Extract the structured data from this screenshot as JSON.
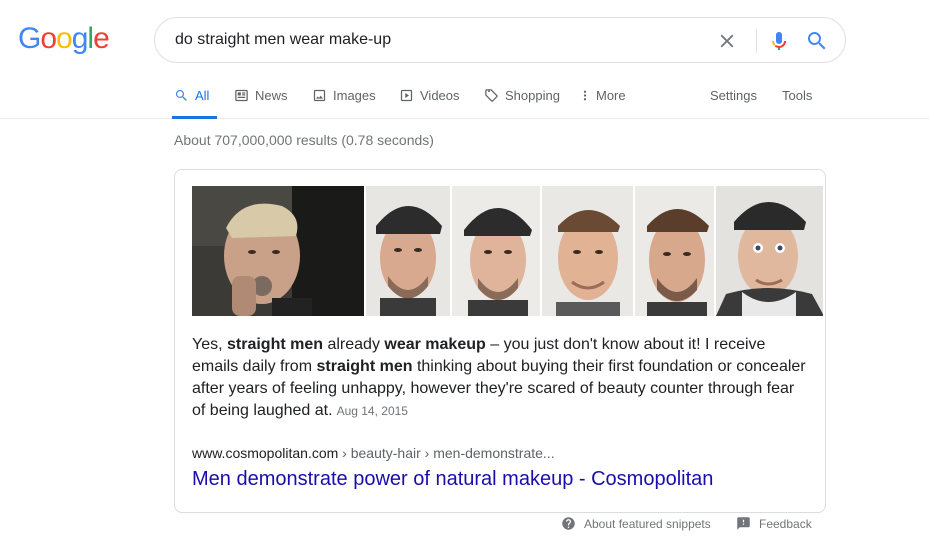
{
  "logo": {
    "letters": [
      {
        "char": "G",
        "color": "#4285F4"
      },
      {
        "char": "o",
        "color": "#EA4335"
      },
      {
        "char": "o",
        "color": "#FBBC05"
      },
      {
        "char": "g",
        "color": "#4285F4"
      },
      {
        "char": "l",
        "color": "#34A853"
      },
      {
        "char": "e",
        "color": "#EA4335"
      }
    ]
  },
  "search": {
    "query": "do straight men wear make-up",
    "clear_icon": "close-icon",
    "mic_icon": "microphone-icon",
    "search_icon": "search-icon"
  },
  "tabs": [
    {
      "label": "All",
      "icon": "search-icon",
      "active": true
    },
    {
      "label": "News",
      "icon": "newspaper-icon"
    },
    {
      "label": "Images",
      "icon": "image-icon"
    },
    {
      "label": "Videos",
      "icon": "video-icon"
    },
    {
      "label": "Shopping",
      "icon": "tag-icon"
    },
    {
      "label": "More",
      "icon": "more-vertical-icon"
    }
  ],
  "tools": {
    "settings": "Settings",
    "tools": "Tools"
  },
  "result_stats": "About 707,000,000 results (0.78 seconds)",
  "snippet": {
    "images_count_visible": 6,
    "segments": [
      {
        "text": "Yes, ",
        "bold": false
      },
      {
        "text": "straight men",
        "bold": true
      },
      {
        "text": " already ",
        "bold": false
      },
      {
        "text": "wear makeup",
        "bold": true
      },
      {
        "text": " – you just don't know about it! I receive emails daily from ",
        "bold": false
      },
      {
        "text": "straight men",
        "bold": true
      },
      {
        "text": " thinking about buying their first foundation or concealer after years of feeling unhappy, however they're scared of beauty counter through fear of being laughed at.",
        "bold": false
      }
    ],
    "date": "Aug 14, 2015",
    "site": "www.cosmopolitan.com",
    "breadcrumbs": " › beauty-hair › men-demonstrate...",
    "title": "Men demonstrate power of natural makeup - Cosmopolitan"
  },
  "footer": {
    "about": "About featured snippets",
    "feedback": "Feedback"
  },
  "colors": {
    "accent": "#1a73e8",
    "link": "#1a0dab",
    "muted": "#70757a"
  }
}
